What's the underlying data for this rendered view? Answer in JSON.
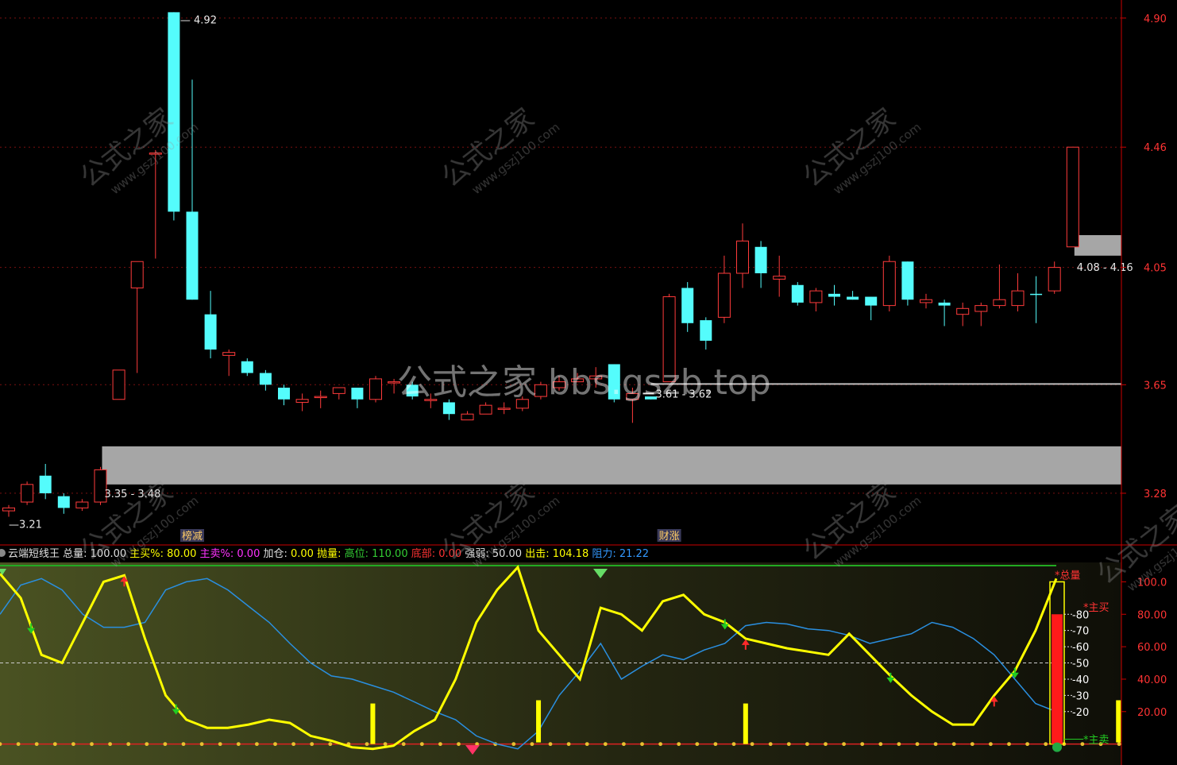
{
  "chart_data": [
    {
      "type": "candlestick",
      "name_text": "",
      "y_ticks": [
        "4.90",
        "4.46",
        "4.05",
        "3.65",
        "3.28"
      ],
      "y_tick_values": [
        4.9,
        4.46,
        4.05,
        3.65,
        3.28
      ],
      "ylim": [
        3.12,
        4.94
      ],
      "candles": [
        {
          "o": 3.22,
          "h": 3.24,
          "l": 3.2,
          "c": 3.23,
          "up": true
        },
        {
          "o": 3.25,
          "h": 3.32,
          "l": 3.24,
          "c": 3.31,
          "up": true
        },
        {
          "o": 3.34,
          "h": 3.38,
          "l": 3.26,
          "c": 3.28,
          "up": false
        },
        {
          "o": 3.27,
          "h": 3.28,
          "l": 3.21,
          "c": 3.23,
          "up": false
        },
        {
          "o": 3.23,
          "h": 3.26,
          "l": 3.22,
          "c": 3.25,
          "up": true
        },
        {
          "o": 3.25,
          "h": 3.37,
          "l": 3.24,
          "c": 3.36,
          "up": true
        },
        {
          "o": 3.6,
          "h": 3.7,
          "l": 3.6,
          "c": 3.7,
          "up": true
        },
        {
          "o": 3.98,
          "h": 4.07,
          "l": 3.69,
          "c": 4.07,
          "up": true
        },
        {
          "o": 4.44,
          "h": 4.45,
          "l": 4.08,
          "c": 4.44,
          "up": true
        },
        {
          "o": 4.92,
          "h": 4.92,
          "l": 4.21,
          "c": 4.24,
          "up": false
        },
        {
          "o": 4.24,
          "h": 4.69,
          "l": 3.94,
          "c": 3.94,
          "up": false
        },
        {
          "o": 3.89,
          "h": 3.97,
          "l": 3.74,
          "c": 3.77,
          "up": false
        },
        {
          "o": 3.75,
          "h": 3.77,
          "l": 3.68,
          "c": 3.76,
          "up": true
        },
        {
          "o": 3.73,
          "h": 3.74,
          "l": 3.68,
          "c": 3.69,
          "up": false
        },
        {
          "o": 3.69,
          "h": 3.7,
          "l": 3.63,
          "c": 3.65,
          "up": false
        },
        {
          "o": 3.64,
          "h": 3.65,
          "l": 3.58,
          "c": 3.6,
          "up": false
        },
        {
          "o": 3.59,
          "h": 3.62,
          "l": 3.56,
          "c": 3.6,
          "up": true
        },
        {
          "o": 3.61,
          "h": 3.63,
          "l": 3.57,
          "c": 3.61,
          "up": true
        },
        {
          "o": 3.62,
          "h": 3.64,
          "l": 3.6,
          "c": 3.64,
          "up": true
        },
        {
          "o": 3.64,
          "h": 3.64,
          "l": 3.57,
          "c": 3.6,
          "up": false
        },
        {
          "o": 3.6,
          "h": 3.68,
          "l": 3.59,
          "c": 3.67,
          "up": true
        },
        {
          "o": 3.66,
          "h": 3.67,
          "l": 3.62,
          "c": 3.66,
          "up": true
        },
        {
          "o": 3.65,
          "h": 3.66,
          "l": 3.6,
          "c": 3.61,
          "up": false
        },
        {
          "o": 3.6,
          "h": 3.62,
          "l": 3.57,
          "c": 3.6,
          "up": true
        },
        {
          "o": 3.59,
          "h": 3.6,
          "l": 3.53,
          "c": 3.55,
          "up": false
        },
        {
          "o": 3.53,
          "h": 3.56,
          "l": 3.53,
          "c": 3.55,
          "up": true
        },
        {
          "o": 3.55,
          "h": 3.59,
          "l": 3.55,
          "c": 3.58,
          "up": true
        },
        {
          "o": 3.57,
          "h": 3.59,
          "l": 3.55,
          "c": 3.57,
          "up": true
        },
        {
          "o": 3.57,
          "h": 3.61,
          "l": 3.56,
          "c": 3.6,
          "up": true
        },
        {
          "o": 3.61,
          "h": 3.66,
          "l": 3.6,
          "c": 3.65,
          "up": true
        },
        {
          "o": 3.64,
          "h": 3.68,
          "l": 3.63,
          "c": 3.66,
          "up": true
        },
        {
          "o": 3.66,
          "h": 3.69,
          "l": 3.66,
          "c": 3.67,
          "up": true
        },
        {
          "o": 3.67,
          "h": 3.71,
          "l": 3.64,
          "c": 3.68,
          "up": true
        },
        {
          "o": 3.72,
          "h": 3.72,
          "l": 3.59,
          "c": 3.6,
          "up": false
        },
        {
          "o": 3.6,
          "h": 3.64,
          "l": 3.52,
          "c": 3.62,
          "up": true
        },
        {
          "o": 3.61,
          "h": 3.61,
          "l": 3.6,
          "c": 3.6,
          "up": false
        },
        {
          "o": 3.66,
          "h": 3.96,
          "l": 3.66,
          "c": 3.95,
          "up": true
        },
        {
          "o": 3.98,
          "h": 4.0,
          "l": 3.83,
          "c": 3.86,
          "up": false
        },
        {
          "o": 3.87,
          "h": 3.88,
          "l": 3.77,
          "c": 3.8,
          "up": false
        },
        {
          "o": 3.88,
          "h": 4.09,
          "l": 3.86,
          "c": 4.03,
          "up": true
        },
        {
          "o": 4.03,
          "h": 4.2,
          "l": 3.98,
          "c": 4.14,
          "up": true
        },
        {
          "o": 4.12,
          "h": 4.14,
          "l": 3.98,
          "c": 4.03,
          "up": false
        },
        {
          "o": 4.01,
          "h": 4.09,
          "l": 3.95,
          "c": 4.02,
          "up": true
        },
        {
          "o": 3.99,
          "h": 4.0,
          "l": 3.92,
          "c": 3.93,
          "up": false
        },
        {
          "o": 3.93,
          "h": 3.98,
          "l": 3.9,
          "c": 3.97,
          "up": true
        },
        {
          "o": 3.96,
          "h": 3.99,
          "l": 3.92,
          "c": 3.95,
          "up": false
        },
        {
          "o": 3.95,
          "h": 3.97,
          "l": 3.94,
          "c": 3.94,
          "up": false
        },
        {
          "o": 3.95,
          "h": 3.95,
          "l": 3.87,
          "c": 3.92,
          "up": false
        },
        {
          "o": 3.92,
          "h": 4.09,
          "l": 3.9,
          "c": 4.07,
          "up": true
        },
        {
          "o": 4.07,
          "h": 4.07,
          "l": 3.92,
          "c": 3.94,
          "up": false
        },
        {
          "o": 3.93,
          "h": 3.96,
          "l": 3.91,
          "c": 3.94,
          "up": true
        },
        {
          "o": 3.93,
          "h": 3.94,
          "l": 3.85,
          "c": 3.92,
          "up": false
        },
        {
          "o": 3.89,
          "h": 3.93,
          "l": 3.85,
          "c": 3.91,
          "up": true
        },
        {
          "o": 3.9,
          "h": 3.93,
          "l": 3.85,
          "c": 3.92,
          "up": true
        },
        {
          "o": 3.92,
          "h": 4.06,
          "l": 3.91,
          "c": 3.94,
          "up": true
        },
        {
          "o": 3.92,
          "h": 4.03,
          "l": 3.9,
          "c": 3.97,
          "up": true
        },
        {
          "o": 3.96,
          "h": 4.02,
          "l": 3.86,
          "c": 3.96,
          "up": false
        },
        {
          "o": 3.97,
          "h": 4.07,
          "l": 3.96,
          "c": 4.05,
          "up": true
        },
        {
          "o": 4.12,
          "h": 4.46,
          "l": 4.12,
          "c": 4.46,
          "up": true
        }
      ],
      "zones": [
        {
          "from": 3.31,
          "to": 3.44,
          "label": "3.35 - 3.48",
          "x_start_index": 5
        },
        {
          "from": 4.09,
          "to": 4.16,
          "label": "4.08 - 4.16",
          "x_start_index": 58
        }
      ],
      "line_levels": [
        {
          "value": 3.62,
          "label": "3.61 - 3.62",
          "x_start_index": 35
        }
      ],
      "marks": [
        {
          "label": "4.92",
          "index": 9
        },
        {
          "label": "3.21",
          "index": 0
        }
      ],
      "events": [
        {
          "label": "榜减",
          "index": 10
        },
        {
          "label": "财涨",
          "index": 36
        }
      ]
    },
    {
      "type": "line",
      "indicator_name": "云端短线王",
      "legend": [
        {
          "k": "总量:",
          "v": "100.00",
          "kc": "#e0e0e0",
          "vc": "#e0e0e0"
        },
        {
          "k": "主买%:",
          "v": "80.00",
          "kc": "#ffff00",
          "vc": "#ffff00"
        },
        {
          "k": "主卖%:",
          "v": "0.00",
          "kc": "#ff33ff",
          "vc": "#ff33ff"
        },
        {
          "k": "加仓:",
          "v": "0.00",
          "kc": "#e0e0e0",
          "vc": "#ffff00"
        },
        {
          "k": "抛量:",
          "v": "",
          "kc": "#ffff00",
          "vc": "#ffff00"
        },
        {
          "k": "高位:",
          "v": "110.00",
          "kc": "#33cc33",
          "vc": "#33cc33"
        },
        {
          "k": "底部:",
          "v": "0.00",
          "kc": "#ff3333",
          "vc": "#ff3333"
        },
        {
          "k": "强弱:",
          "v": "50.00",
          "kc": "#e0e0e0",
          "vc": "#e0e0e0"
        },
        {
          "k": "出击:",
          "v": "104.18",
          "kc": "#ffff00",
          "vc": "#ffff00"
        },
        {
          "k": "阻力:",
          "v": "21.22",
          "kc": "#3399ff",
          "vc": "#3399ff"
        }
      ],
      "y_ticks": [
        "100.0",
        "80.00",
        "60.00",
        "40.00",
        "20.00"
      ],
      "y_tick_values": [
        100,
        80,
        60,
        40,
        20
      ],
      "ylim": [
        -9,
        110
      ],
      "bar_scale": [
        "80",
        "70",
        "60",
        "50",
        "40",
        "30",
        "20"
      ],
      "bar_scale_values": [
        80,
        70,
        60,
        50,
        40,
        30,
        20
      ],
      "series_yellow": [
        105,
        90,
        55,
        50,
        75,
        100,
        104,
        65,
        30,
        15,
        10,
        10,
        12,
        15,
        13,
        5,
        2,
        -2,
        -3,
        -1,
        8,
        15,
        40,
        75,
        95,
        109,
        70,
        55,
        40,
        84,
        80,
        70,
        88,
        92,
        80,
        75,
        65,
        62,
        59,
        57,
        55,
        68,
        55,
        42,
        30,
        20,
        12,
        12,
        30,
        45,
        70,
        102
      ],
      "series_blue": [
        80,
        98,
        102,
        95,
        80,
        72,
        72,
        75,
        95,
        100,
        102,
        95,
        85,
        75,
        62,
        50,
        42,
        40,
        36,
        32,
        26,
        20,
        15,
        5,
        0,
        -3,
        8,
        30,
        45,
        62,
        40,
        48,
        55,
        52,
        58,
        62,
        73,
        75,
        74,
        71,
        70,
        67,
        62,
        65,
        68,
        75,
        72,
        65,
        55,
        40,
        25,
        20
      ],
      "big_bar": {
        "from": 0,
        "to": 80,
        "top": 100
      },
      "yellow_pillars": [
        {
          "index": 18,
          "top": 25,
          "bottom": 0
        },
        {
          "index": 26,
          "top": 27,
          "bottom": 1
        },
        {
          "index": 36,
          "top": 25,
          "bottom": 0
        },
        {
          "index": 54,
          "top": 27,
          "bottom": 1
        }
      ],
      "arrows_down_green": [
        1.5,
        8.5,
        35,
        43,
        49
      ],
      "arrows_up_red": [
        6,
        36,
        48,
        56
      ],
      "right_labels": {
        "zongliang": "*总量",
        "zhumai": "*主买",
        "zhumai2": "*主卖"
      }
    }
  ],
  "watermark": {
    "text": "公式之家 bbs.gszb.top",
    "tile_cn": "公式之家",
    "tile_url": "www.gszj100.com"
  },
  "colors": {
    "up": "#ff3b3b",
    "down": "#54fcfc",
    "axis": "#cc0000",
    "yellow": "#ffff00",
    "blue": "#2a8fe0",
    "zone": "#a6a6a6"
  }
}
